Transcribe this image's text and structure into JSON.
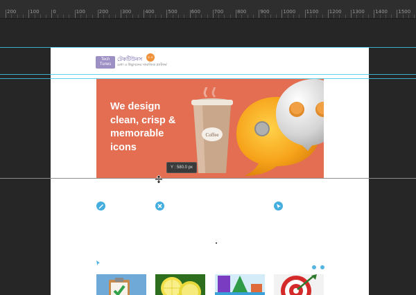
{
  "ruler": {
    "labels": [
      "200",
      "100",
      "0",
      "100",
      "200",
      "300",
      "400",
      "500",
      "600",
      "700",
      "800",
      "900",
      "1000",
      "1100",
      "1200",
      "1300",
      "1400",
      "1500"
    ]
  },
  "logo": {
    "box_line1": "Tech",
    "box_line2": "Tunes",
    "bengali_name": "টেকটিউনস",
    "tagline": "মেধা ও উদ্ভাবনের সামাজিক প্ল্যাটফর্ম",
    "badge": "৫.৪"
  },
  "hero": {
    "line1": "We design",
    "line2": "clean, crisp &",
    "line3": "memorable",
    "line4": "icons",
    "cup_label": "Coffee"
  },
  "readout": {
    "text": "Y :  580.0 px"
  },
  "colors": {
    "accent": "#44aede",
    "hero_bg": "#e36e52",
    "guide": "#3ec9e8"
  },
  "icons": {
    "feature_1": "pencil-icon",
    "feature_2": "tools-icon",
    "feature_3": "cursor-icon"
  }
}
